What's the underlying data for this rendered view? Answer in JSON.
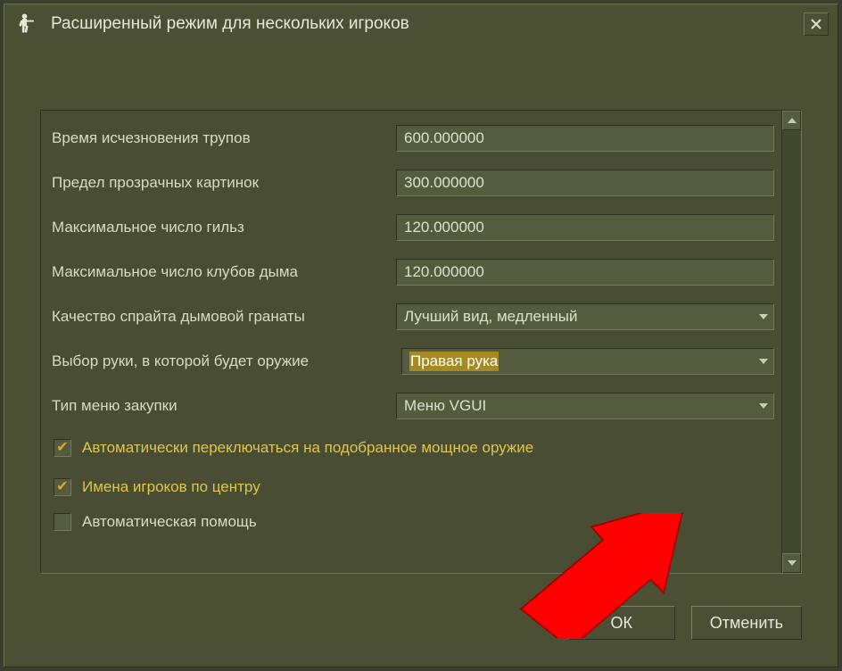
{
  "window": {
    "title": "Расширенный режим для нескольких игроков"
  },
  "settings": [
    {
      "label": "Время исчезновения трупов",
      "type": "text",
      "value": "600.000000"
    },
    {
      "label": "Предел прозрачных картинок",
      "type": "text",
      "value": "300.000000"
    },
    {
      "label": "Максимальное число гильз",
      "type": "text",
      "value": "120.000000"
    },
    {
      "label": "Максимальное число клубов дыма",
      "type": "text",
      "value": "120.000000"
    },
    {
      "label": "Качество спрайта дымовой гранаты",
      "type": "select",
      "value": "Лучший вид, медленный",
      "highlight": false
    },
    {
      "label": "Выбор руки, в которой будет оружие",
      "type": "select",
      "value": "Правая рука",
      "highlight": true
    },
    {
      "label": "Тип меню закупки",
      "type": "select",
      "value": "Меню VGUI",
      "highlight": false
    }
  ],
  "checkboxes": [
    {
      "label": "Автоматически переключаться на подобранное мощное оружие",
      "checked": true
    },
    {
      "label": "Имена игроков по центру",
      "checked": true
    },
    {
      "label": "Автоматическая помощь",
      "checked": false
    }
  ],
  "buttons": {
    "ok": "ОК",
    "cancel": "Отменить"
  },
  "icons": {
    "app": "counter-terrorist-icon",
    "close": "close-icon"
  }
}
